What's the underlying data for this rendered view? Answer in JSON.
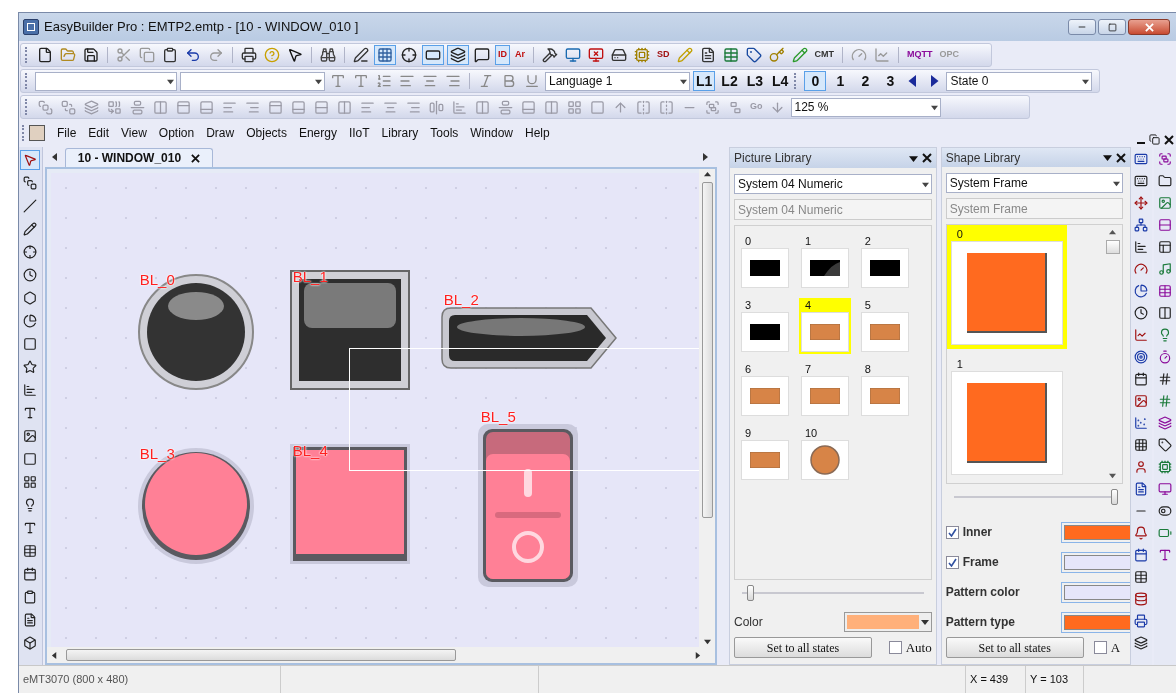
{
  "window": {
    "title": "EasyBuilder Pro : EMTP2.emtp - [10 - WINDOW_010 ]"
  },
  "toolbar": {
    "labels": [
      "ID",
      "Ar",
      "SD",
      "CMT",
      "MQTT",
      "OPC",
      "Go"
    ],
    "toggles": [
      {
        "selected": true
      },
      {
        "selected": true
      },
      {
        "selected": true
      },
      {
        "selected": true
      }
    ],
    "language": "Language 1",
    "languages": [
      {
        "label": "L1",
        "selected": true
      },
      {
        "label": "L2",
        "selected": false
      },
      {
        "label": "L3",
        "selected": false
      },
      {
        "label": "L4",
        "selected": false
      }
    ],
    "states": [
      {
        "label": "0",
        "selected": true
      },
      {
        "label": "1",
        "selected": false
      },
      {
        "label": "2",
        "selected": false
      },
      {
        "label": "3",
        "selected": false
      }
    ],
    "state": "State  0",
    "zoom": "125 %"
  },
  "menu": [
    "File",
    "Edit",
    "View",
    "Option",
    "Draw",
    "Objects",
    "Energy",
    "IIoT",
    "Library",
    "Tools",
    "Window",
    "Help"
  ],
  "tab": {
    "label": "10 - WINDOW_010",
    "selected": true
  },
  "canvas": {
    "objects": [
      {
        "label": "BL_0",
        "kind": "round-dark"
      },
      {
        "label": "BL_1",
        "kind": "square-dark"
      },
      {
        "label": "BL_2",
        "kind": "arrow-dark"
      },
      {
        "label": "BL_3",
        "kind": "round-pink"
      },
      {
        "label": "BL_4",
        "kind": "square-pink"
      },
      {
        "label": "BL_5",
        "kind": "switch-pink"
      }
    ]
  },
  "picture_library": {
    "title": "Picture Library",
    "category": "System 04 Numeric",
    "name": "System 04 Numeric",
    "items": [
      {
        "label": "0",
        "kind": "black",
        "selected": false
      },
      {
        "label": "1",
        "kind": "black-glossy",
        "selected": false
      },
      {
        "label": "2",
        "kind": "black",
        "selected": false
      },
      {
        "label": "3",
        "kind": "black",
        "selected": false
      },
      {
        "label": "4",
        "kind": "brown",
        "selected": true
      },
      {
        "label": "5",
        "kind": "brown",
        "selected": false
      },
      {
        "label": "6",
        "kind": "brown",
        "selected": false
      },
      {
        "label": "7",
        "kind": "brown",
        "selected": false
      },
      {
        "label": "8",
        "kind": "brown",
        "selected": false
      },
      {
        "label": "9",
        "kind": "brown",
        "selected": false
      },
      {
        "label": "10",
        "kind": "brown-disc",
        "selected": false
      }
    ],
    "slider": {
      "level": 0.03
    },
    "color_label": "Color",
    "color": "#ffb07a",
    "apply": "Set to all states",
    "auto": {
      "label": "Auto",
      "checked": false
    }
  },
  "shape_library": {
    "title": "Shape Library",
    "category": "System Frame",
    "name": "System Frame",
    "items": [
      {
        "label": "0",
        "selected": true
      },
      {
        "label": "1",
        "selected": false
      }
    ],
    "slider": {
      "level": 1
    },
    "properties": [
      {
        "label": "Inner",
        "kind": "check",
        "checked": true,
        "color": "#ff6a1f"
      },
      {
        "label": "Frame",
        "kind": "check",
        "checked": true,
        "color": "#e6e6fa"
      },
      {
        "label": "Pattern color",
        "kind": "plain",
        "color": "#e6e6fa"
      },
      {
        "label": "Pattern type",
        "kind": "plain",
        "color": "#ff6a1f"
      }
    ],
    "apply": "Set to all states",
    "auto": {
      "label": "A",
      "checked": false
    }
  },
  "status_bar": {
    "device": "eMT3070 (800 x 480)",
    "x": "X = 439",
    "y": "Y = 103"
  }
}
